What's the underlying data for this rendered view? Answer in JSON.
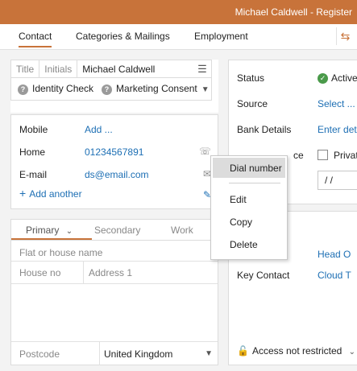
{
  "window": {
    "title": "Michael Caldwell - Register"
  },
  "tabs": [
    {
      "label": "Contact"
    },
    {
      "label": "Categories & Mailings"
    },
    {
      "label": "Employment"
    }
  ],
  "name": {
    "title_placeholder": "Title",
    "initials_placeholder": "Initials",
    "full_name": "Michael Caldwell",
    "identity_check": "Identity Check",
    "marketing_consent": "Marketing Consent"
  },
  "contacts": {
    "mobile_label": "Mobile",
    "mobile_value": "Add ...",
    "home_label": "Home",
    "home_value": "01234567891",
    "email_label": "E-mail",
    "email_value": "ds@email.com",
    "add_another": "Add another"
  },
  "address": {
    "tabs": [
      "Primary",
      "Secondary",
      "Work"
    ],
    "flat_placeholder": "Flat or house name",
    "house_no_placeholder": "House no",
    "address1_placeholder": "Address 1",
    "postcode_placeholder": "Postcode",
    "country": "United Kingdom"
  },
  "details": {
    "status_label": "Status",
    "status_value": "Active",
    "source_label": "Source",
    "source_value": "Select ...",
    "bank_label": "Bank Details",
    "bank_value": "Enter det",
    "insurance_label_partial": "ce",
    "private_label": "Privat",
    "date_value": "/  /",
    "head_value": "Head O",
    "key_contact_label": "Key Contact",
    "key_contact_value": "Cloud T",
    "access_value": "Access not restricted"
  },
  "context_menu": {
    "items": [
      "Dial number",
      "Edit",
      "Copy",
      "Delete"
    ]
  },
  "icons": {
    "swap": "swap-icon",
    "menu": "hamburger-icon",
    "phone": "phone-icon",
    "mail": "mail-icon",
    "edit": "edit-icon",
    "lock": "lock-icon"
  },
  "colors": {
    "accent": "#c8733a",
    "link": "#1d6fb4"
  }
}
